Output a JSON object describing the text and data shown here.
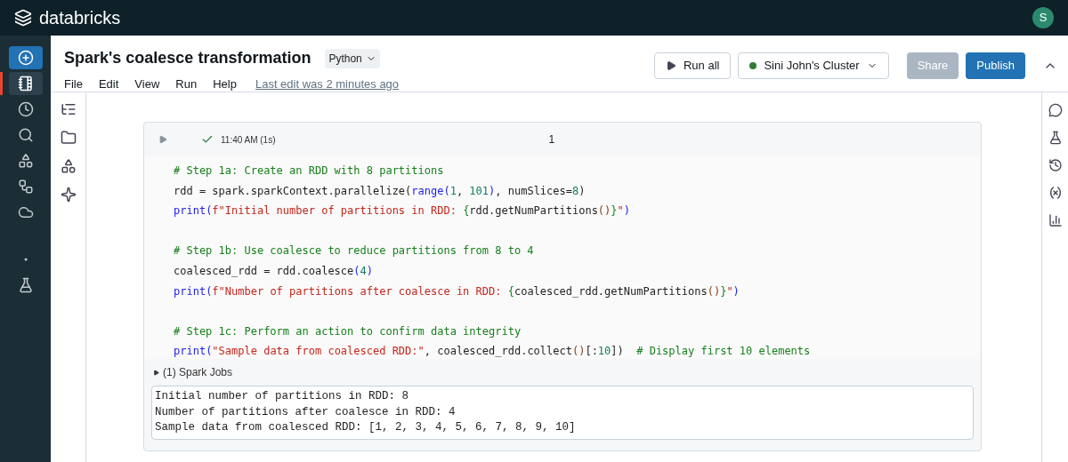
{
  "brand": "databricks",
  "user": {
    "initial": "S"
  },
  "rail": [
    {
      "kind": "create",
      "selected": false
    },
    {
      "kind": "nav",
      "selected": true
    },
    {
      "kind": "nav",
      "selected": false
    },
    {
      "kind": "nav",
      "selected": false
    },
    {
      "kind": "nav",
      "selected": false
    },
    {
      "kind": "nav",
      "selected": false
    },
    {
      "kind": "nav",
      "selected": false
    },
    {
      "kind": "nav",
      "selected": false
    },
    {
      "kind": "nav",
      "selected": false
    }
  ],
  "notebook": {
    "title": "Spark's coalesce transformation",
    "language": "Python",
    "menu": [
      "File",
      "Edit",
      "View",
      "Run",
      "Help"
    ],
    "last_edit": "Last edit was 2 minutes ago"
  },
  "actions": {
    "run_all": "Run all",
    "cluster": {
      "name": "Sini John's Cluster",
      "color": "#2e7d32"
    },
    "share": {
      "label": "Share",
      "disabled": true
    },
    "publish": "Publish"
  },
  "cell": {
    "time": "11:40 AM (1s)",
    "succeeded": true,
    "number": "1",
    "lines": [
      {
        "tokens": [
          {
            "kind": "comment",
            "text": "# Step 1a: Create an RDD with 8 partitions"
          }
        ]
      },
      {
        "tokens": [
          {
            "kind": "plain",
            "text": "rdd = spark.sparkContext.parallelize("
          },
          {
            "kind": "builtin",
            "text": "range"
          },
          {
            "kind": "punct",
            "text": "("
          },
          {
            "kind": "number",
            "text": "1"
          },
          {
            "kind": "plain",
            "text": ", "
          },
          {
            "kind": "number",
            "text": "101"
          },
          {
            "kind": "punct",
            "text": ")"
          },
          {
            "kind": "plain",
            "text": ", numSlices="
          },
          {
            "kind": "number",
            "text": "8"
          },
          {
            "kind": "plain",
            "text": ")"
          }
        ]
      },
      {
        "tokens": [
          {
            "kind": "builtin",
            "text": "print"
          },
          {
            "kind": "punct",
            "text": "("
          },
          {
            "kind": "string",
            "text": "f\"Initial number of partitions in RDD: "
          },
          {
            "kind": "brace",
            "text": "{"
          },
          {
            "kind": "plain",
            "text": "rdd.getNumPartitions"
          },
          {
            "kind": "paren",
            "text": "()"
          },
          {
            "kind": "brace",
            "text": "}"
          },
          {
            "kind": "string",
            "text": "\""
          },
          {
            "kind": "punct",
            "text": ")"
          }
        ]
      },
      {
        "spaced": true,
        "tokens": [
          {
            "kind": "comment",
            "text": "# Step 1b: Use coalesce to reduce partitions from 8 to 4"
          }
        ]
      },
      {
        "tokens": [
          {
            "kind": "plain",
            "text": "coalesced_rdd = rdd.coalesce"
          },
          {
            "kind": "punct",
            "text": "("
          },
          {
            "kind": "number",
            "text": "4"
          },
          {
            "kind": "punct",
            "text": ")"
          }
        ]
      },
      {
        "tokens": [
          {
            "kind": "builtin",
            "text": "print"
          },
          {
            "kind": "punct",
            "text": "("
          },
          {
            "kind": "string",
            "text": "f\"Number of partitions after coalesce in RDD: "
          },
          {
            "kind": "brace",
            "text": "{"
          },
          {
            "kind": "plain",
            "text": "coalesced_rdd.getNumPartitions"
          },
          {
            "kind": "paren",
            "text": "()"
          },
          {
            "kind": "brace",
            "text": "}"
          },
          {
            "kind": "string",
            "text": "\""
          },
          {
            "kind": "punct",
            "text": ")"
          }
        ]
      },
      {
        "spaced": true,
        "tokens": [
          {
            "kind": "comment",
            "text": "# Step 1c: Perform an action to confirm data integrity"
          }
        ]
      },
      {
        "tokens": [
          {
            "kind": "builtin",
            "text": "print"
          },
          {
            "kind": "punct",
            "text": "("
          },
          {
            "kind": "string",
            "text": "\"Sample data from coalesced RDD:\""
          },
          {
            "kind": "plain",
            "text": ", coalesced_rdd.collect"
          },
          {
            "kind": "paren",
            "text": "()"
          },
          {
            "kind": "plain",
            "text": "[:"
          },
          {
            "kind": "number",
            "text": "10"
          },
          {
            "kind": "plain",
            "text": "])  "
          },
          {
            "kind": "comment",
            "text": "# Display first 10 elements"
          }
        ]
      }
    ],
    "jobs": {
      "label": "(1) Spark Jobs",
      "expanded": false
    },
    "output": [
      "Initial number of partitions in RDD: 8",
      "Number of partitions after coalesce in RDD: 4",
      "Sample data from coalesced RDD: [1, 2, 3, 4, 5, 6, 7, 8, 9, 10]"
    ]
  }
}
